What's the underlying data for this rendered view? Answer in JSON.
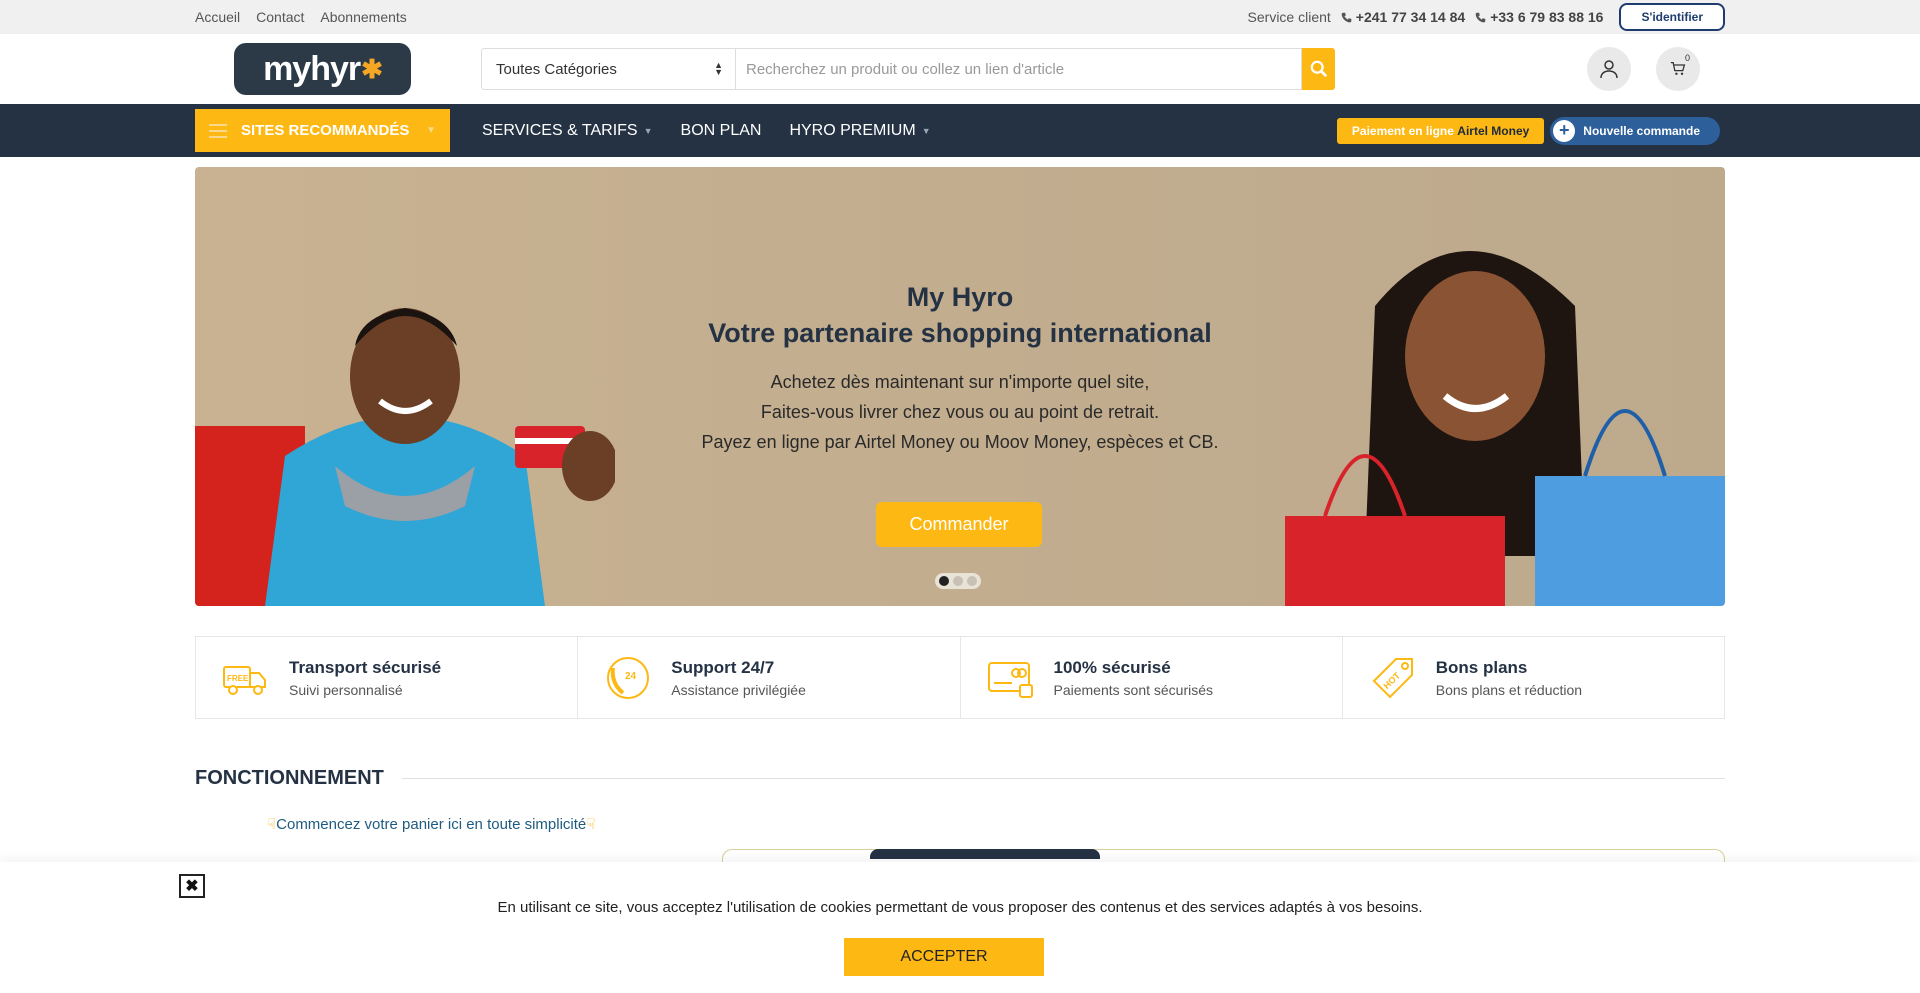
{
  "topbar": {
    "links": [
      "Accueil",
      "Contact",
      "Abonnements"
    ],
    "service_label": "Service client",
    "phone1": "+241 77 34 14 84",
    "phone2": "+33 6 79 83 88 16",
    "login": "S'identifier"
  },
  "header": {
    "logo_text": "myhyr",
    "category_select": "Toutes Catégories",
    "search_placeholder": "Recherchez un produit ou collez un lien d'article",
    "cart_count": "0"
  },
  "nav": {
    "recommended": "SITES RECOMMANDÉS",
    "menu": [
      "SERVICES & TARIFS",
      "BON PLAN",
      "HYRO PREMIUM"
    ],
    "pay_prefix": "Paiement en ligne",
    "pay_brand": "Airtel Money",
    "new_order": "Nouvelle commande"
  },
  "hero": {
    "title_line1": "My Hyro",
    "title_line2": "Votre partenaire shopping international",
    "text_line1": "Achetez dès maintenant sur n'importe quel site,",
    "text_line2": "Faites-vous livrer chez vous ou au point de retrait.",
    "text_line3": "Payez en ligne par Airtel Money ou Moov Money, espèces et CB.",
    "cta": "Commander"
  },
  "features": [
    {
      "title": "Transport sécurisé",
      "subtitle": "Suivi personnalisé",
      "icon": "delivery-truck-icon"
    },
    {
      "title": "Support 24/7",
      "subtitle": "Assistance privilégiée",
      "icon": "support-24-icon"
    },
    {
      "title": "100% sécurisé",
      "subtitle": "Paiements sont sécurisés",
      "icon": "secure-payment-icon"
    },
    {
      "title": "Bons plans",
      "subtitle": "Bons plans et réduction",
      "icon": "hot-tag-icon"
    }
  ],
  "section": {
    "title": "FONCTIONNEMENT",
    "start_text": "Commencez votre panier ici en toute simplicité"
  },
  "cookie": {
    "message": "En utilisant ce site, vous acceptez l'utilisation de cookies permettant de vous proposer des contenus et des services adaptés à vos besoins.",
    "accept": "ACCEPTER",
    "close": "✖"
  },
  "colors": {
    "accent": "#fdb813",
    "nav_bg": "#243244",
    "link_blue": "#1f5b80"
  }
}
